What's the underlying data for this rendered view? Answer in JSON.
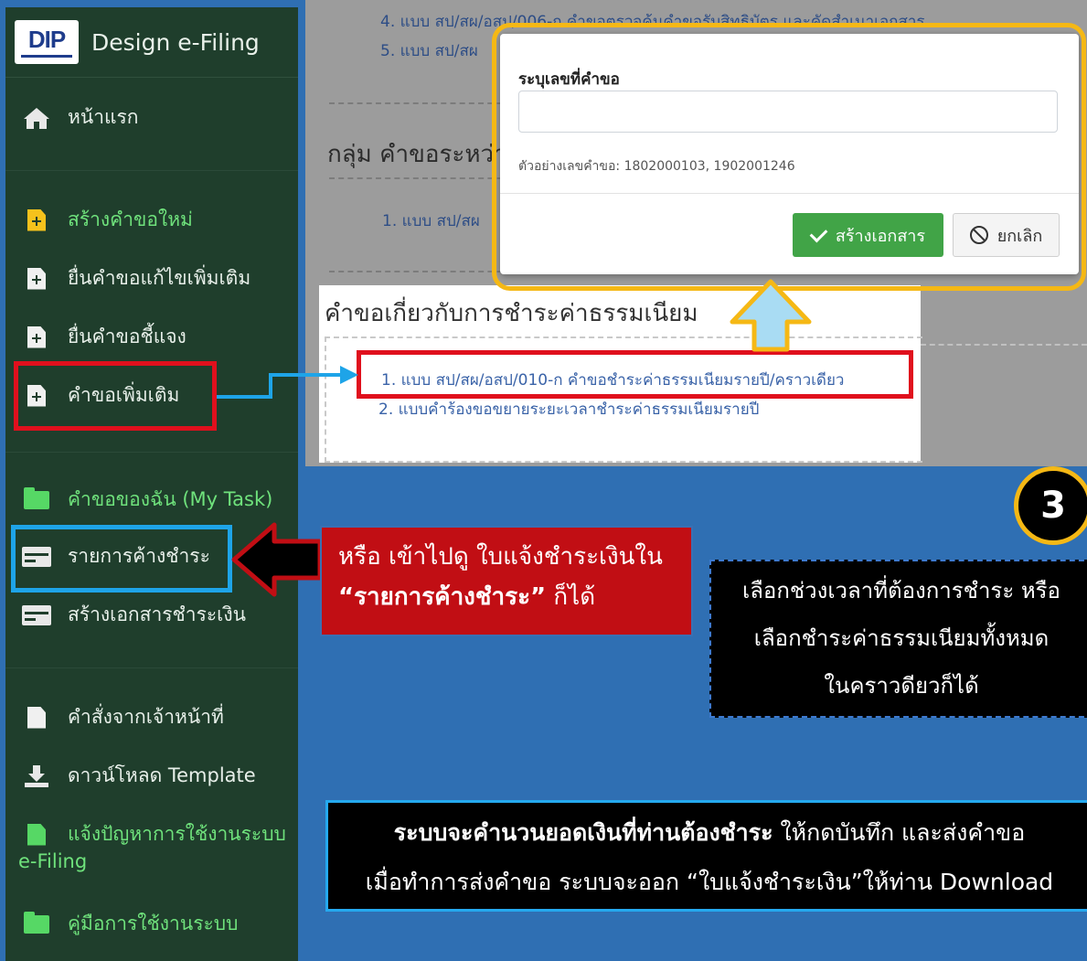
{
  "sidebar": {
    "logo_text": "DIP",
    "brand_title": "Design e-Filing",
    "items": [
      {
        "label": "หน้าแรก",
        "icon": "home-icon"
      },
      {
        "label": "สร้างคำขอใหม่",
        "icon": "file-plus-icon"
      },
      {
        "label": "ยื่นคำขอแก้ไขเพิ่มเติม",
        "icon": "file-plus-icon"
      },
      {
        "label": "ยื่นคำขอชี้แจง",
        "icon": "file-plus-icon"
      },
      {
        "label": "คำขอเพิ่มเติม",
        "icon": "file-plus-icon"
      },
      {
        "label": "คำขอของฉัน (My Task)",
        "icon": "folder-icon"
      },
      {
        "label": "รายการค้างชำระ",
        "icon": "payment-card-icon"
      },
      {
        "label": "สร้างเอกสารชำระเงิน",
        "icon": "payment-card-icon"
      },
      {
        "label": "คำสั่งจากเจ้าหน้าที่",
        "icon": "document-icon"
      },
      {
        "label": "ดาวน์โหลด Template",
        "icon": "download-icon"
      },
      {
        "label": "แจ้งปัญหาการใช้งานระบบ",
        "label2": "e-Filing",
        "icon": "file-icon"
      },
      {
        "label": "คู่มือการใช้งานระบบ",
        "icon": "folder-icon"
      }
    ]
  },
  "background": {
    "item4": "4. แบบ สป/สผ/อสป/006-ก คำขอตรวจค้นคำขอรับสิทธิบัตร และคัดสำเนาเอกสาร",
    "item5": "5. แบบ สป/สผ",
    "group_heading": "กลุ่ม คำขอระหว่าง",
    "group_item1": "1. แบบ สป/สผ"
  },
  "fee_section": {
    "title": "คำขอเกี่ยวกับการชำระค่าธรรมเนียม",
    "links": [
      "1. แบบ สป/สผ/อสป/010-ก คำขอชำระค่าธรรมเนียมรายปี/คราวเดียว",
      "2. แบบคำร้องขอขยายระยะเวลาชำระค่าธรรมเนียมรายปี"
    ]
  },
  "modal": {
    "label": "ระบุเลขที่คำขอ",
    "input_value": "",
    "help_text": "ตัวอย่างเลขคำขอ: 1802000103, 1902001246",
    "create_button": "สร้างเอกสาร",
    "cancel_button": "ยกเลิก"
  },
  "annotations": {
    "step_number": "3",
    "red_callout_line1": "หรือ เข้าไปดู ใบแจ้งชำระเงินใน",
    "red_callout_bold": "“รายการค้างชำระ”",
    "red_callout_tail": " ก็ได้",
    "black_callout_lines": [
      "เลือกช่วงเวลาที่ต้องการชำระ หรือ",
      "เลือกชำระค่าธรรมเนียมทั้งหมด",
      "ในคราวดียวก็ได้"
    ],
    "bottom_bold": "ระบบจะคำนวนยอดเงินที่ท่านต้องชำระ",
    "bottom_rest": " ให้กดบันทึก และส่งคำขอ",
    "bottom_line2": "เมื่อทำการส่งคำขอ ระบบจะออก “ใบแจ้งชำระเงิน”ให้ท่าน Download"
  },
  "colors": {
    "sidebar_bg": "#1f3e2c",
    "page_bg": "#2f6fb3",
    "accent_green": "#56d865",
    "highlight_red": "#e0101d",
    "highlight_blue": "#1ea4e8",
    "highlight_yellow": "#f5b815"
  }
}
